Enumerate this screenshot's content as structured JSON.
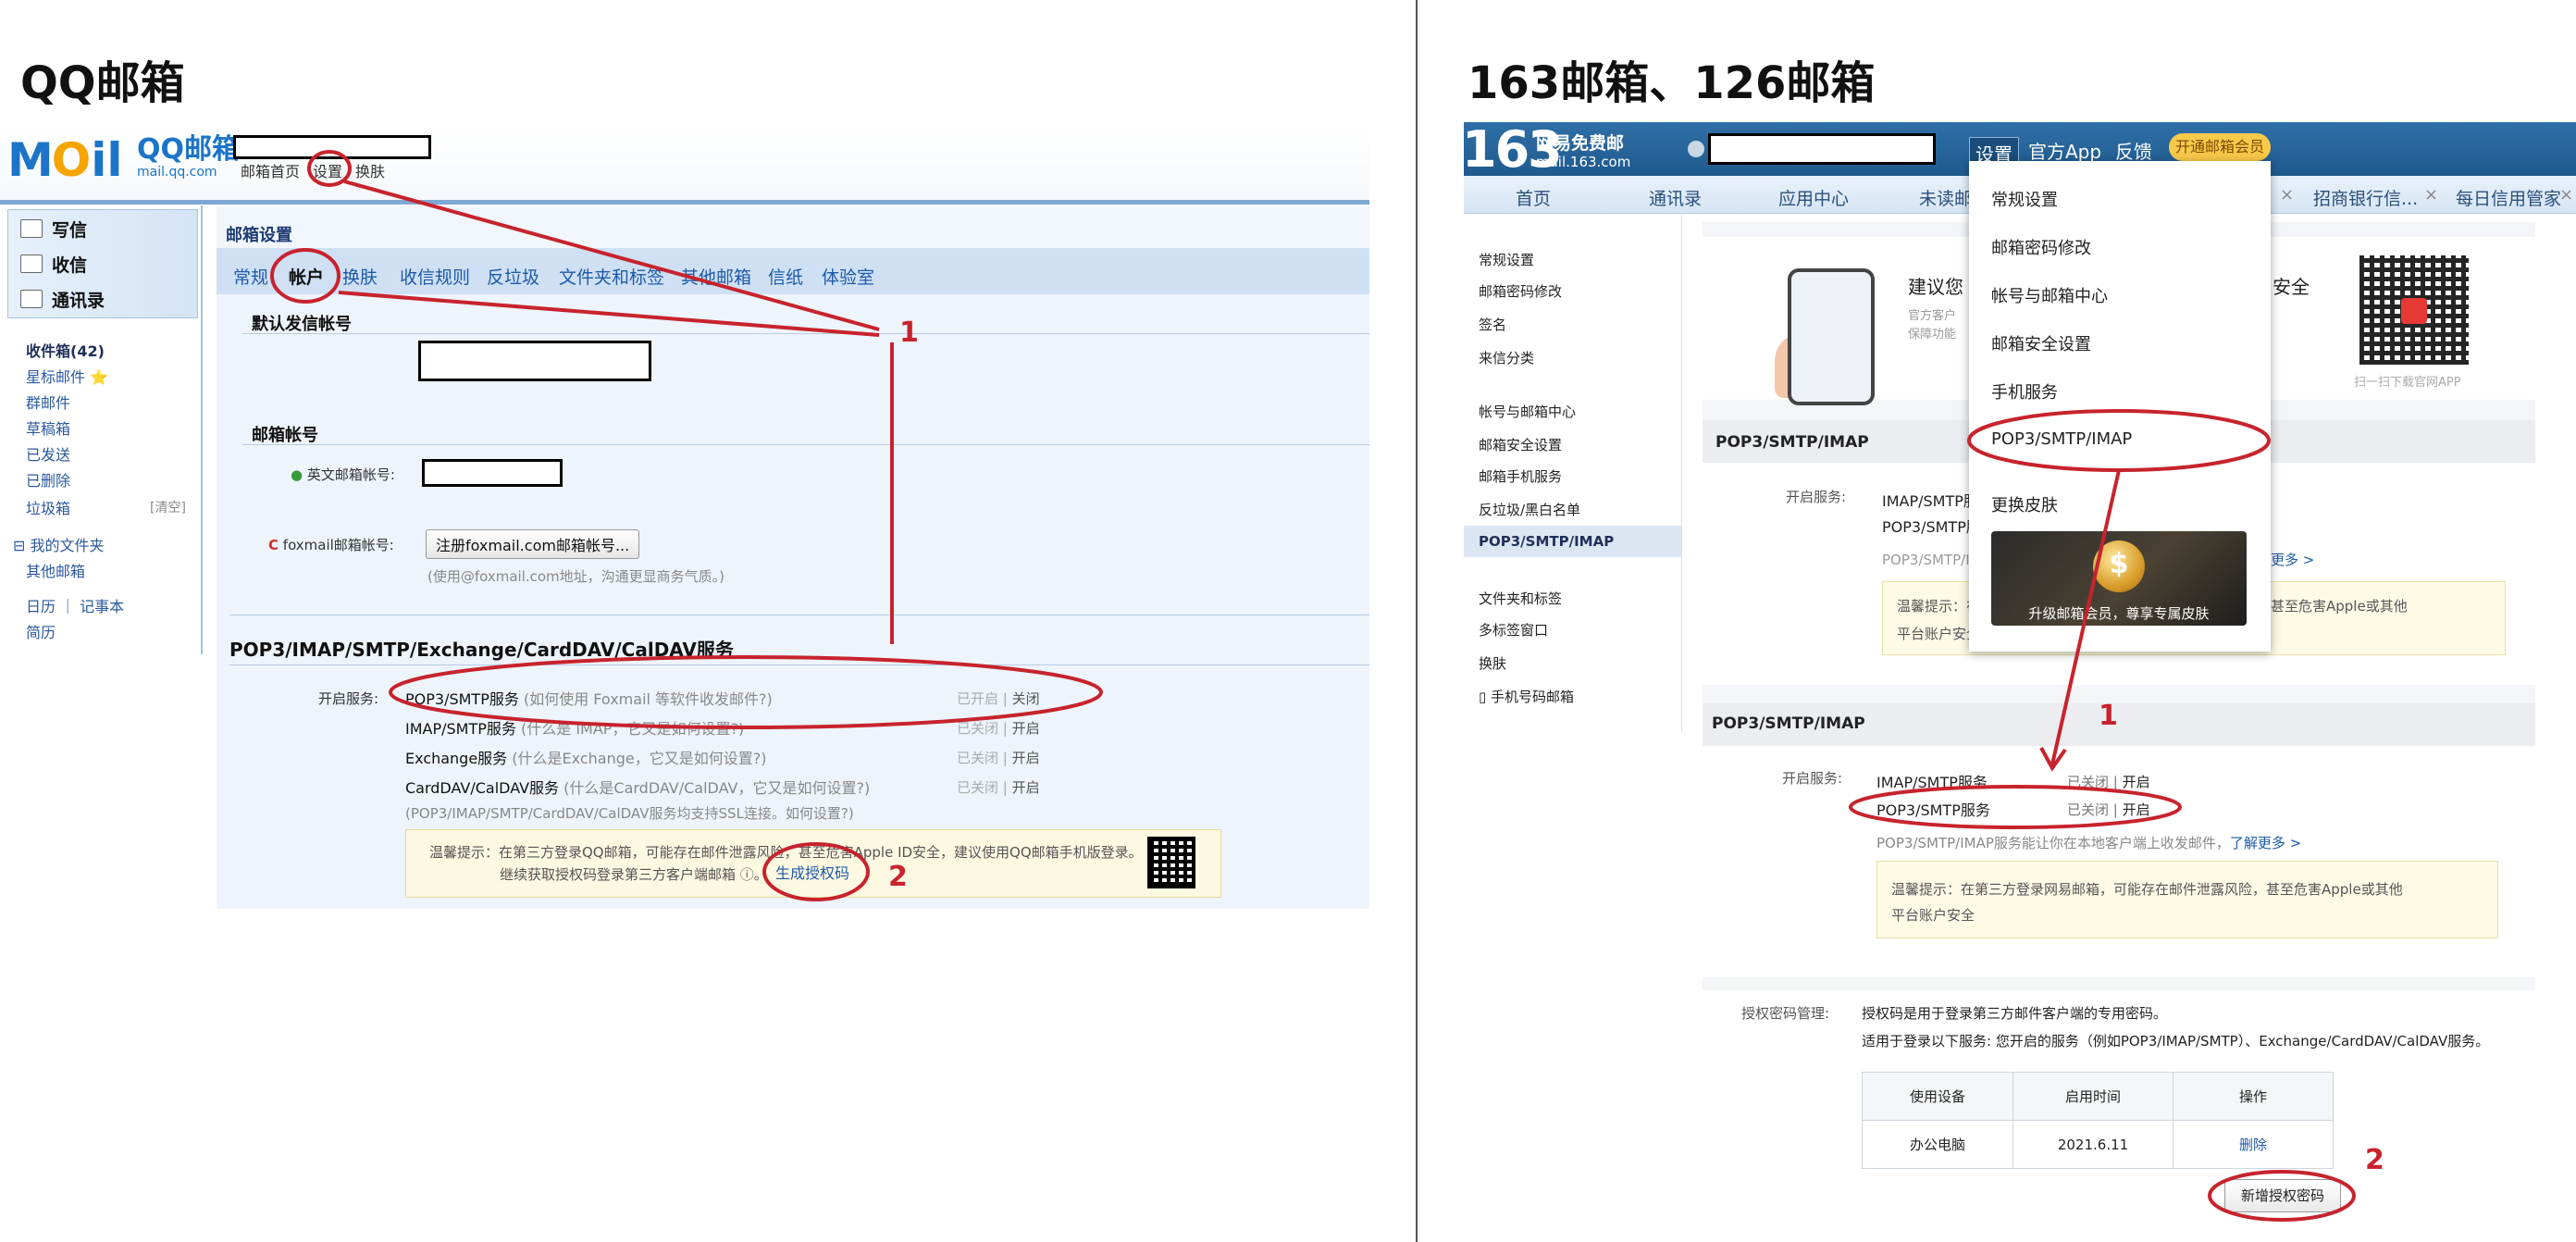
{
  "titles": {
    "left": "QQ邮箱",
    "right": "163邮箱、126邮箱"
  },
  "qq": {
    "logo_main": "M",
    "logo_o": "O",
    "logo_il": "il",
    "logo_cn": "QQ邮箱",
    "logo_domain": "mail.qq.com",
    "nav": [
      "邮箱首页",
      "设置",
      "换肤"
    ],
    "compose": [
      "写信",
      "收信",
      "通讯录"
    ],
    "folders": [
      "收件箱(42)",
      "星标邮件 ⭐",
      "群邮件",
      "草稿箱",
      "已发送",
      "已删除",
      "垃圾箱",
      "⊟ 我的文件夹",
      "其他邮箱",
      "日历 ｜ 记事本",
      "简历"
    ],
    "clear": "[清空]",
    "main_title": "邮箱设置",
    "tabs": [
      "常规",
      "帐户",
      "换肤",
      "收信规则",
      "反垃圾",
      "文件夹和标签",
      "其他邮箱",
      "信纸",
      "体验室"
    ],
    "default_sender": "默认发信帐号",
    "mailbox_account": "邮箱帐号",
    "english_account_label": "英文邮箱帐号:",
    "foxmail_label": "foxmail邮箱帐号:",
    "foxmail_button": "注册foxmail.com邮箱帐号...",
    "foxmail_note": "(使用@foxmail.com地址，沟通更显商务气质。)",
    "pop_title": "POP3/IMAP/SMTP/Exchange/CardDAV/CalDAV服务",
    "enable_label": "开启服务:",
    "services": [
      {
        "name": "POP3/SMTP服务",
        "hint": "(如何使用 Foxmail 等软件收发邮件?)",
        "state": "已开启",
        "action": "关闭"
      },
      {
        "name": "IMAP/SMTP服务",
        "hint": "(什么是 IMAP，它又是如何设置?)",
        "state": "已关闭",
        "action": "开启"
      },
      {
        "name": "Exchange服务",
        "hint": "(什么是Exchange，它又是如何设置?)",
        "state": "已关闭",
        "action": "开启"
      },
      {
        "name": "CardDAV/CalDAV服务",
        "hint": "(什么是CardDAV/CalDAV，它又是如何设置?)",
        "state": "已关闭",
        "action": "开启"
      }
    ],
    "ssl_note": "(POP3/IMAP/SMTP/CardDAV/CalDAV服务均支持SSL连接。如何设置?)",
    "warn_line1": "温馨提示：在第三方登录QQ邮箱，可能存在邮件泄露风险，甚至危害Apple ID安全，建议使用QQ邮箱手机版登录。",
    "warn_line2": "继续获取授权码登录第三方客户端邮箱 ⓘ。",
    "gen_code": "生成授权码"
  },
  "netease": {
    "logo_num": "163",
    "logo_title": "网易免费邮",
    "logo_domain": "mail.163.com",
    "menu": [
      "设置",
      "官方App",
      "反馈"
    ],
    "vip_button": "开通邮箱会员",
    "tabs": [
      "首页",
      "通讯录",
      "应用中心",
      "未读邮",
      "招商银行信...",
      "每日信用管家"
    ],
    "left_items": [
      "常规设置",
      "邮箱密码修改",
      "签名",
      "来信分类",
      "帐号与邮箱中心",
      "邮箱安全设置",
      "邮箱手机服务",
      "反垃圾/黑白名单",
      "POP3/SMTP/IMAP",
      "文件夹和标签",
      "多标签窗口",
      "换肤",
      "手机号码邮箱"
    ],
    "dropdown": [
      "常规设置",
      "邮箱密码修改",
      "帐号与邮箱中心",
      "邮箱安全设置",
      "手机服务",
      "POP3/SMTP/IMAP",
      "更换皮肤"
    ],
    "vip_promo": "升级邮箱会员，尊享专属皮肤",
    "promo_title": "建议您",
    "promo_title_end": "安全",
    "promo_sub1": "官方客户",
    "promo_sub2": "保障功能",
    "qr_caption": "扫一扫下载官网APP",
    "section_title": "POP3/SMTP/IMAP",
    "enable_label": "开启服务:",
    "bg_services": [
      "IMAP/SMTP服",
      "POP3/SMTP服"
    ],
    "bg_note": "POP3/SMTP/I",
    "bg_learn": "更多 >",
    "bg_warn1": "温馨提示：在",
    "bg_warn1_end": "甚至危害Apple或其他",
    "bg_warn2": "平台账户安全",
    "services": [
      {
        "name": "IMAP/SMTP服务",
        "state": "已关闭",
        "action": "开启"
      },
      {
        "name": "POP3/SMTP服务",
        "state": "已关闭",
        "action": "开启"
      }
    ],
    "service_note": "POP3/SMTP/IMAP服务能让你在本地客户端上收发邮件，",
    "learn_more": "了解更多 >",
    "warn1": "温馨提示：在第三方登录网易邮箱，可能存在邮件泄露风险，甚至危害Apple或其他",
    "warn2": "平台账户安全",
    "auth_label": "授权密码管理:",
    "auth_desc1": "授权码是用于登录第三方邮件客户端的专用密码。",
    "auth_desc2": "适用于登录以下服务: 您开启的服务（例如POP3/IMAP/SMTP）、Exchange/CardDAV/CalDAV服务。",
    "table_headers": [
      "使用设备",
      "启用时间",
      "操作"
    ],
    "table_rows": [
      [
        "办公电脑",
        "2021.6.11",
        "删除"
      ]
    ],
    "add_button": "新增授权密码"
  },
  "annotations": {
    "step1": "1",
    "step2": "2"
  },
  "colors": {
    "annotation": "#c7232d",
    "qq_blue": "#1b74c7",
    "netease_blue": "#1f5a8d"
  }
}
